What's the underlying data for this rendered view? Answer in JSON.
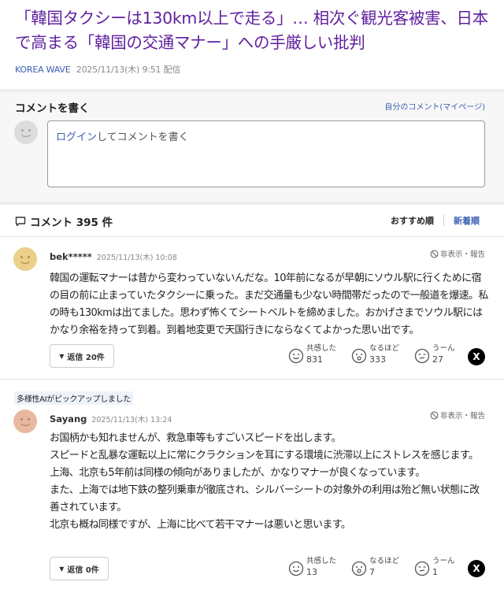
{
  "article": {
    "title": "「韓国タクシーは130km以上で走る」… 相次ぐ観光客被害、日本で高まる「韓国の交通マナー」への手厳しい批判",
    "source": "KOREA WAVE",
    "datetime": "2025/11/13(木) 9:51 配信"
  },
  "compose": {
    "heading": "コメントを書く",
    "mypage_link": "自分のコメント(マイページ)",
    "login_text": "ログイン",
    "placeholder_rest": "してコメントを書く"
  },
  "list": {
    "title": "コメント 395 件",
    "sort_recommended": "おすすめ順",
    "sort_newest": "新着順"
  },
  "comments": [
    {
      "pickup": "",
      "user": "bek*****",
      "time": "2025/11/13(木) 10:08",
      "hide_report": "非表示・報告",
      "text": "韓国の運転マナーは昔から変わっていないんだな。10年前になるが早朝にソウル駅に行くために宿の目の前に止まっていたタクシーに乗った。まだ交通量も少ない時間帯だったので一般道を爆速。私の時も130kmは出てました。思わず怖くてシートベルトを締めました。おかげさまでソウル駅にはかなり余裕を持って到着。到着地変更で天国行きにならなくてよかった思い出です。",
      "reply": "返信 20件",
      "reactions": [
        {
          "label": "共感した",
          "count": "831"
        },
        {
          "label": "なるほど",
          "count": "333"
        },
        {
          "label": "うーん",
          "count": "27"
        }
      ],
      "avatar_color": "#ead08a"
    },
    {
      "pickup": "多様性AIがピックアップしました",
      "user": "Sayang",
      "time": "2025/11/13(木) 13:24",
      "hide_report": "非表示・報告",
      "text": "お国柄かも知れませんが、救急車等もすごいスピードを出します。\nスピードと乱暴な運転以上に常にクラクションを耳にする環境に渋滞以上にストレスを感じます。\n上海、北京も5年前は同様の傾向がありましたが、かなりマナーが良くなっています。\nまた、上海では地下鉄の整列乗車が徹底され、シルバーシートの対象外の利用は殆ど無い状態に改善されています。\n北京も概ね同様ですが、上海に比べて若干マナーは悪いと思います。",
      "reply": "返信 0件",
      "reactions": [
        {
          "label": "共感した",
          "count": "13"
        },
        {
          "label": "なるほど",
          "count": "7"
        },
        {
          "label": "うーん",
          "count": "1"
        }
      ],
      "avatar_color": "#e8b9a0"
    }
  ],
  "share_label": "X",
  "colors": {
    "title": "#5f1f9e",
    "link": "#3a5fb4",
    "pickup_bg": "#eef3fb"
  }
}
